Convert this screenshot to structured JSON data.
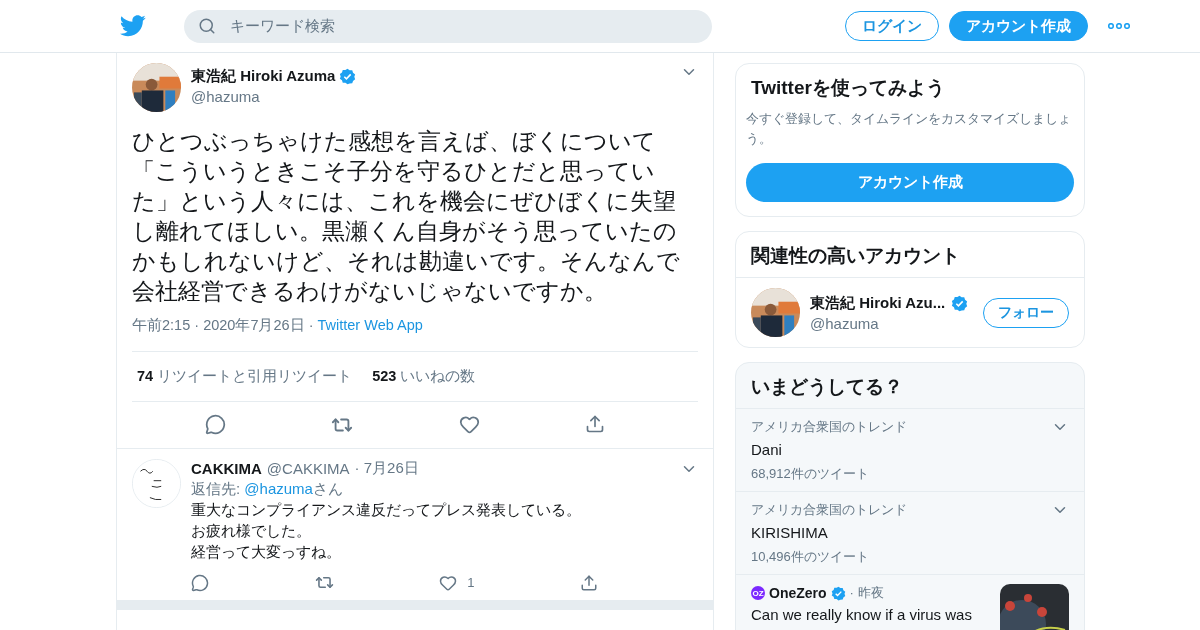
{
  "header": {
    "search": {
      "placeholder": "キーワード検索"
    },
    "buttons": [
      {
        "label": "ログイン",
        "kind": "outline"
      },
      {
        "label": "アカウント作成",
        "kind": "filled"
      }
    ]
  },
  "tweet": {
    "name": "東浩紀 Hiroki Azuma",
    "verified": true,
    "handle": "@hazuma",
    "text": "ひとつぶっちゃけた感想を言えば、ぼくについて「こういうときこそ子分を守るひとだと思っていた」という人々には、これを機会にぜひぼくに失望し離れてほしい。黒瀬くん自身がそう思っていたのかもしれないけど、それは勘違いです。そんなんで会社経営できるわけがないじゃないですか。",
    "time": "午前2:15",
    "sep1": "·",
    "date": "2020年7月26日",
    "sep2": "·",
    "source": "Twitter Web App",
    "stats": [
      "**74** リツイートと引用リツイート",
      "**523** いいねの数"
    ]
  },
  "replies": [
    {
      "name": "CAKKIMA",
      "handle": "@CAKKIMA",
      "sep": "·",
      "date": "7月26日",
      "reply_prefix": "返信先: ",
      "reply_to": "@hazuma",
      "reply_suffix": "さん",
      "lines": [
        "重大なコンプライアンス違反だってプレス発表している。",
        "お疲れ様でした。",
        "経営って大変っすね。"
      ],
      "likes": "1"
    }
  ],
  "signup": {
    "title": "Twitterを使ってみよう",
    "text": "今すぐ登録して、タイムラインをカスタマイズしましょう。",
    "button": "アカウント作成"
  },
  "related": {
    "title": "関連性の高いアカウント",
    "accounts": [
      {
        "name": "東浩紀 Hiroki Azu...",
        "verified": true,
        "handle": "@hazuma",
        "button": "フォロー"
      }
    ]
  },
  "trends": {
    "title": "いまどうしてる？",
    "items": [
      {
        "kind": "trend",
        "context": "アメリカ合衆国のトレンド",
        "topic": "Dani",
        "count": "68,912件のツイート"
      },
      {
        "kind": "trend",
        "context": "アメリカ合衆国のトレンド",
        "topic": "KIRISHIMA",
        "count": "10,496件のツイート"
      },
      {
        "kind": "news",
        "source": "OneZero",
        "source_logo": "OZ",
        "verified": true,
        "sep": "·",
        "time": "昨夜",
        "headline": "Can we really know if a virus was"
      }
    ]
  }
}
